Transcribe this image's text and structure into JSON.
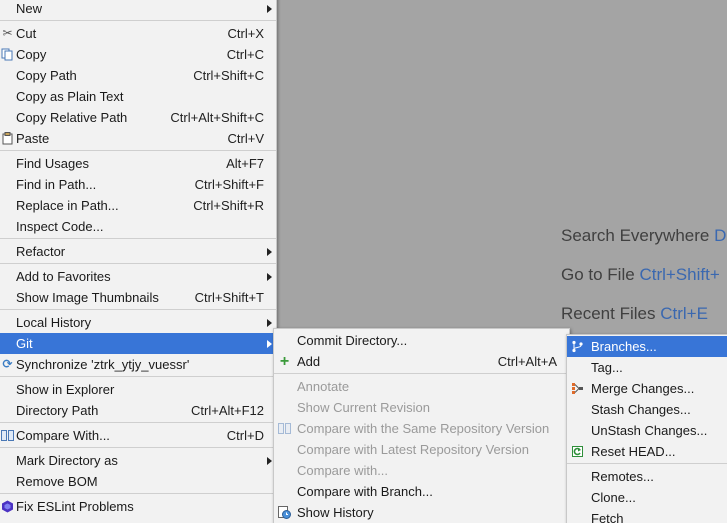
{
  "hints": [
    {
      "label": "Search Everywhere",
      "key": "Do"
    },
    {
      "label": "Go to File",
      "key": "Ctrl+Shift+"
    },
    {
      "label": "Recent Files",
      "key": "Ctrl+E"
    }
  ],
  "main_menu": [
    {
      "label": "New",
      "shortcut": "",
      "submenu": true
    },
    {
      "label": "Cut",
      "shortcut": "Ctrl+X",
      "icon": "scissors-icon"
    },
    {
      "label": "Copy",
      "shortcut": "Ctrl+C",
      "icon": "copy-icon"
    },
    {
      "label": "Copy Path",
      "shortcut": "Ctrl+Shift+C"
    },
    {
      "label": "Copy as Plain Text",
      "shortcut": ""
    },
    {
      "label": "Copy Relative Path",
      "shortcut": "Ctrl+Alt+Shift+C"
    },
    {
      "label": "Paste",
      "shortcut": "Ctrl+V",
      "icon": "paste-icon"
    },
    {
      "label": "Find Usages",
      "shortcut": "Alt+F7"
    },
    {
      "label": "Find in Path...",
      "shortcut": "Ctrl+Shift+F"
    },
    {
      "label": "Replace in Path...",
      "shortcut": "Ctrl+Shift+R"
    },
    {
      "label": "Inspect Code...",
      "shortcut": ""
    },
    {
      "label": "Refactor",
      "shortcut": "",
      "submenu": true
    },
    {
      "label": "Add to Favorites",
      "shortcut": "",
      "submenu": true
    },
    {
      "label": "Show Image Thumbnails",
      "shortcut": "Ctrl+Shift+T"
    },
    {
      "label": "Local History",
      "shortcut": "",
      "submenu": true
    },
    {
      "label": "Git",
      "shortcut": "",
      "submenu": true,
      "selected": true
    },
    {
      "label": "Synchronize 'ztrk_ytjy_vuessr'",
      "shortcut": "",
      "icon": "sync-icon"
    },
    {
      "label": "Show in Explorer",
      "shortcut": ""
    },
    {
      "label": "Directory Path",
      "shortcut": "Ctrl+Alt+F12"
    },
    {
      "label": "Compare With...",
      "shortcut": "Ctrl+D",
      "icon": "compare-icon"
    },
    {
      "label": "Mark Directory as",
      "shortcut": "",
      "submenu": true
    },
    {
      "label": "Remove BOM",
      "shortcut": ""
    },
    {
      "label": "Fix ESLint Problems",
      "shortcut": "",
      "icon": "eslint-icon"
    }
  ],
  "git_menu": [
    {
      "label": "Commit Directory...",
      "shortcut": ""
    },
    {
      "label": "Add",
      "shortcut": "Ctrl+Alt+A",
      "icon": "plus-icon"
    },
    {
      "label": "Annotate",
      "shortcut": "",
      "disabled": true
    },
    {
      "label": "Show Current Revision",
      "shortcut": "",
      "disabled": true
    },
    {
      "label": "Compare with the Same Repository Version",
      "shortcut": "",
      "disabled": true,
      "icon": "compare-icon"
    },
    {
      "label": "Compare with Latest Repository Version",
      "shortcut": "",
      "disabled": true
    },
    {
      "label": "Compare with...",
      "shortcut": "",
      "disabled": true
    },
    {
      "label": "Compare with Branch...",
      "shortcut": ""
    },
    {
      "label": "Show History",
      "shortcut": "",
      "icon": "history-icon"
    }
  ],
  "repo_menu": [
    {
      "label": "Branches...",
      "selected": true,
      "icon": "branch-icon"
    },
    {
      "label": "Tag..."
    },
    {
      "label": "Merge Changes...",
      "icon": "merge-icon"
    },
    {
      "label": "Stash Changes..."
    },
    {
      "label": "UnStash Changes..."
    },
    {
      "label": "Reset HEAD...",
      "icon": "reset-icon"
    },
    {
      "label": "Remotes..."
    },
    {
      "label": "Clone..."
    },
    {
      "label": "Fetch"
    }
  ]
}
